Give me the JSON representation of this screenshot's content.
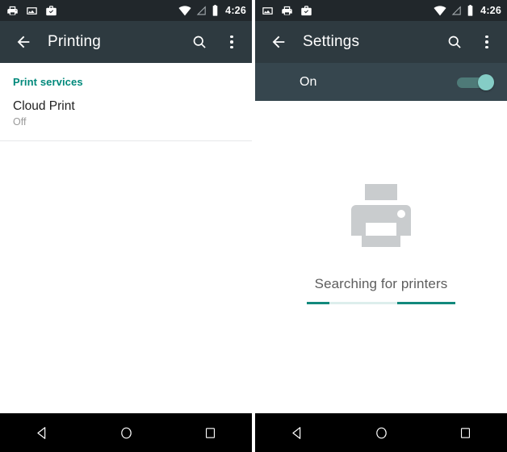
{
  "meta": {
    "accent_teal": "#00897b",
    "toolbar_bg": "#2e3a40",
    "statusbar_bg": "#21272b",
    "switch_thumb": "#85cdc6",
    "navbar_bg": "#000000"
  },
  "left_panel": {
    "statusbar": {
      "icons": [
        "printer-icon",
        "screenshot-icon",
        "work-profile-icon"
      ],
      "wifi_icon": "wifi-icon",
      "signal_icon": "signal-icon",
      "battery_icon": "battery-icon",
      "time": "4:26"
    },
    "toolbar": {
      "back_icon": "back-arrow-icon",
      "title": "Printing",
      "search_icon": "search-icon",
      "overflow_icon": "overflow-menu-icon"
    },
    "section_header": "Print services",
    "items": [
      {
        "title": "Cloud Print",
        "subtitle": "Off"
      }
    ],
    "navbar": {
      "back": "back-triangle-icon",
      "home": "home-circle-icon",
      "recents": "recents-square-icon"
    }
  },
  "right_panel": {
    "statusbar": {
      "icons": [
        "screenshot-icon",
        "printer-icon",
        "work-profile-icon"
      ],
      "wifi_icon": "wifi-icon",
      "signal_icon": "signal-icon",
      "battery_icon": "battery-icon",
      "time": "4:26"
    },
    "toolbar": {
      "back_icon": "back-arrow-icon",
      "title": "Settings",
      "search_icon": "search-icon",
      "overflow_icon": "overflow-menu-icon"
    },
    "toggle": {
      "label": "On",
      "state": "on"
    },
    "empty_state": {
      "illustration": "printer-illustration",
      "text": "Searching for printers",
      "progress": "indeterminate"
    },
    "navbar": {
      "back": "back-triangle-icon",
      "home": "home-circle-icon",
      "recents": "recents-square-icon"
    }
  }
}
